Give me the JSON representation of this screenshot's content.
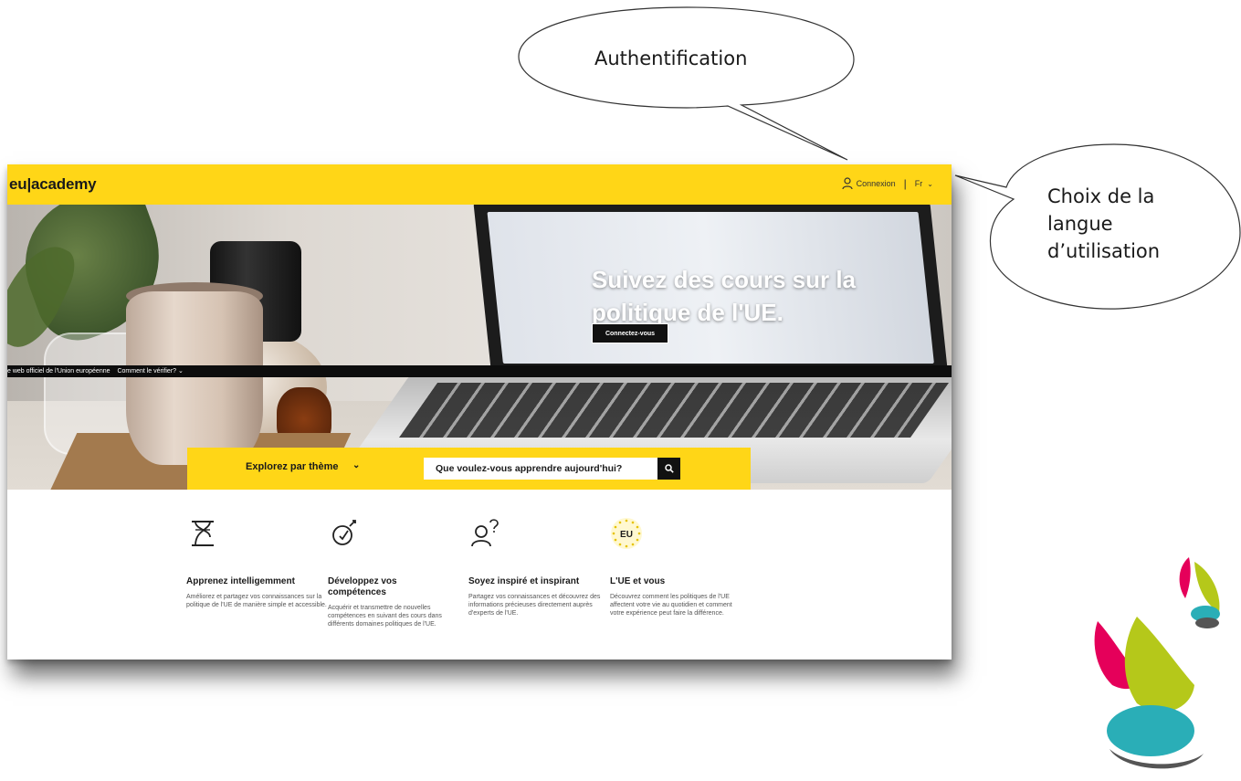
{
  "annotations": {
    "auth_label": "Authentification",
    "language_lines": [
      "Choix de la",
      "langue",
      "d’utilisation"
    ]
  },
  "header": {
    "logo": "eu|academy",
    "login_label": "Connexion",
    "language_label": "Fr"
  },
  "hero": {
    "title": "Suivez des cours sur la politique de l'UE.",
    "cta_label": "Connectez-vous",
    "eu_bar_text": "e web officiel de l'Union européenne",
    "eu_bar_verify": "Comment le vérifier?"
  },
  "search": {
    "explore_label": "Explorez par thème",
    "placeholder": "Que voulez-vous apprendre aujourd'hui?"
  },
  "features": [
    {
      "icon": "hourglass-icon",
      "title": "Apprenez intelligemment",
      "text": "Améliorez et partagez vos connaissances sur la politique de l'UE de manière simple et accessible."
    },
    {
      "icon": "skills-icon",
      "title": "Développez vos compétences",
      "text": "Acquérir et transmettre de nouvelles compétences en suivant des cours dans différents domaines politiques de l'UE."
    },
    {
      "icon": "people-question-icon",
      "title": "Soyez inspiré et inspirant",
      "text": "Partagez vos connaissances et découvrez des informations précieuses directement auprès d'experts de l'UE."
    },
    {
      "icon": "eu-stars-icon",
      "eu_badge": "EU",
      "title": "L'UE et vous",
      "text": "Découvrez comment les politiques de l'UE affectent votre vie au quotidien et comment votre expérience peut faire la différence."
    }
  ],
  "colors": {
    "accent_yellow": "#ffd617",
    "dark": "#111111"
  }
}
